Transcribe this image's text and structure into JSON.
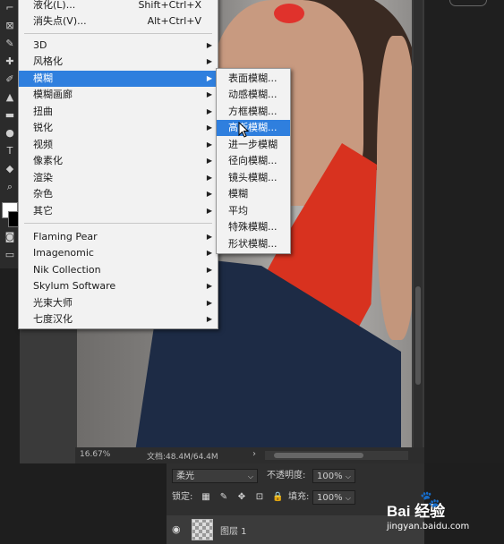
{
  "main_menu": {
    "top_items": [
      {
        "label": "液化(L)...",
        "shortcut": "Shift+Ctrl+X"
      },
      {
        "label": "消失点(V)...",
        "shortcut": "Alt+Ctrl+V"
      }
    ],
    "filter_items": [
      {
        "label": "3D"
      },
      {
        "label": "风格化"
      },
      {
        "label": "模糊"
      },
      {
        "label": "模糊画廊"
      },
      {
        "label": "扭曲"
      },
      {
        "label": "锐化"
      },
      {
        "label": "视频"
      },
      {
        "label": "像素化"
      },
      {
        "label": "渲染"
      },
      {
        "label": "杂色"
      },
      {
        "label": "其它"
      }
    ],
    "plugin_items": [
      {
        "label": "Flaming Pear"
      },
      {
        "label": "Imagenomic"
      },
      {
        "label": "Nik Collection"
      },
      {
        "label": "Skylum Software"
      },
      {
        "label": "光束大师"
      },
      {
        "label": "七度汉化"
      }
    ]
  },
  "blur_submenu": {
    "items": [
      {
        "label": "表面模糊..."
      },
      {
        "label": "动感模糊..."
      },
      {
        "label": "方框模糊..."
      },
      {
        "label": "高斯模糊..."
      },
      {
        "label": "进一步模糊"
      },
      {
        "label": "径向模糊..."
      },
      {
        "label": "镜头模糊..."
      },
      {
        "label": "模糊"
      },
      {
        "label": "平均"
      },
      {
        "label": "特殊模糊..."
      },
      {
        "label": "形状模糊..."
      }
    ]
  },
  "statusbar": {
    "zoom": "16.67%",
    "doc": "文档:48.4M/64.4M",
    "arrow": "›"
  },
  "layers_panel": {
    "blend_mode": "柔光",
    "opacity_label": "不透明度:",
    "opacity_value": "100%",
    "lock_label": "锁定:",
    "fill_label": "填充:",
    "fill_value": "100%",
    "layer_name": "图层 1"
  },
  "watermark": {
    "logo_text": "Bai  经验",
    "site": "jingyan.baidu.com"
  },
  "colors": {
    "menu_bg": "#f2f2f2",
    "highlight": "#2f7fde",
    "panel_bg": "#2f2f2f",
    "app_bg": "#1e1e1e"
  }
}
